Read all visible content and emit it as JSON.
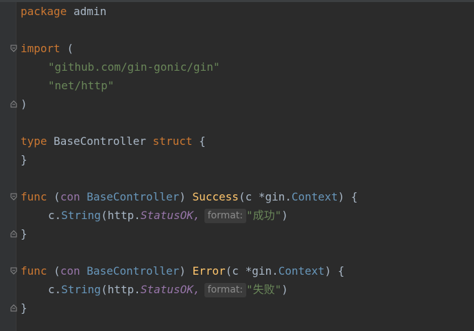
{
  "code": {
    "l1": {
      "kw": "package",
      "name": "admin"
    },
    "l3": {
      "kw": "import",
      "open": "("
    },
    "l4": {
      "path": "\"github.com/gin-gonic/gin\""
    },
    "l5": {
      "path": "\"net/http\""
    },
    "l6": {
      "close": ")"
    },
    "l8": {
      "kw_type": "type",
      "name": "BaseController",
      "kw_struct": "struct",
      "brace": "{"
    },
    "l9": {
      "close": "}"
    },
    "f1": {
      "kw": "func",
      "paren_open": "(",
      "recv": "con",
      "recv_type": "BaseController",
      "paren_close": ")",
      "name": "Success",
      "params_open": "(c *",
      "pkg": "gin",
      "dot": ".",
      "ctx": "Context",
      "params_close": ") {",
      "body_c": "c.",
      "body_fn": "String",
      "body_paren": "(",
      "body_pkg": "http.",
      "body_const": "StatusOK,",
      "hint": "format:",
      "arg": "\"成功\"",
      "end_paren": ")",
      "close": "}"
    },
    "f2": {
      "kw": "func",
      "paren_open": "(",
      "recv": "con",
      "recv_type": "BaseController",
      "paren_close": ")",
      "name": "Error",
      "params_open": "(c *",
      "pkg": "gin",
      "dot": ".",
      "ctx": "Context",
      "params_close": ") {",
      "body_c": "c.",
      "body_fn": "String",
      "body_paren": "(",
      "body_pkg": "http.",
      "body_const": "StatusOK,",
      "hint": "format:",
      "arg": "\"失败\"",
      "end_paren": ")",
      "close": "}"
    }
  },
  "colors": {
    "background": "#2b2b2b",
    "gutter": "#313335",
    "keyword": "#cc7832",
    "string": "#6a8759",
    "function": "#ffc66d",
    "receiver": "#9876aa",
    "type": "#6897bb",
    "text": "#a9b7c6",
    "hint_bg": "#3b3b3b"
  },
  "icons": [
    "fold-open-icon",
    "fold-close-icon"
  ]
}
